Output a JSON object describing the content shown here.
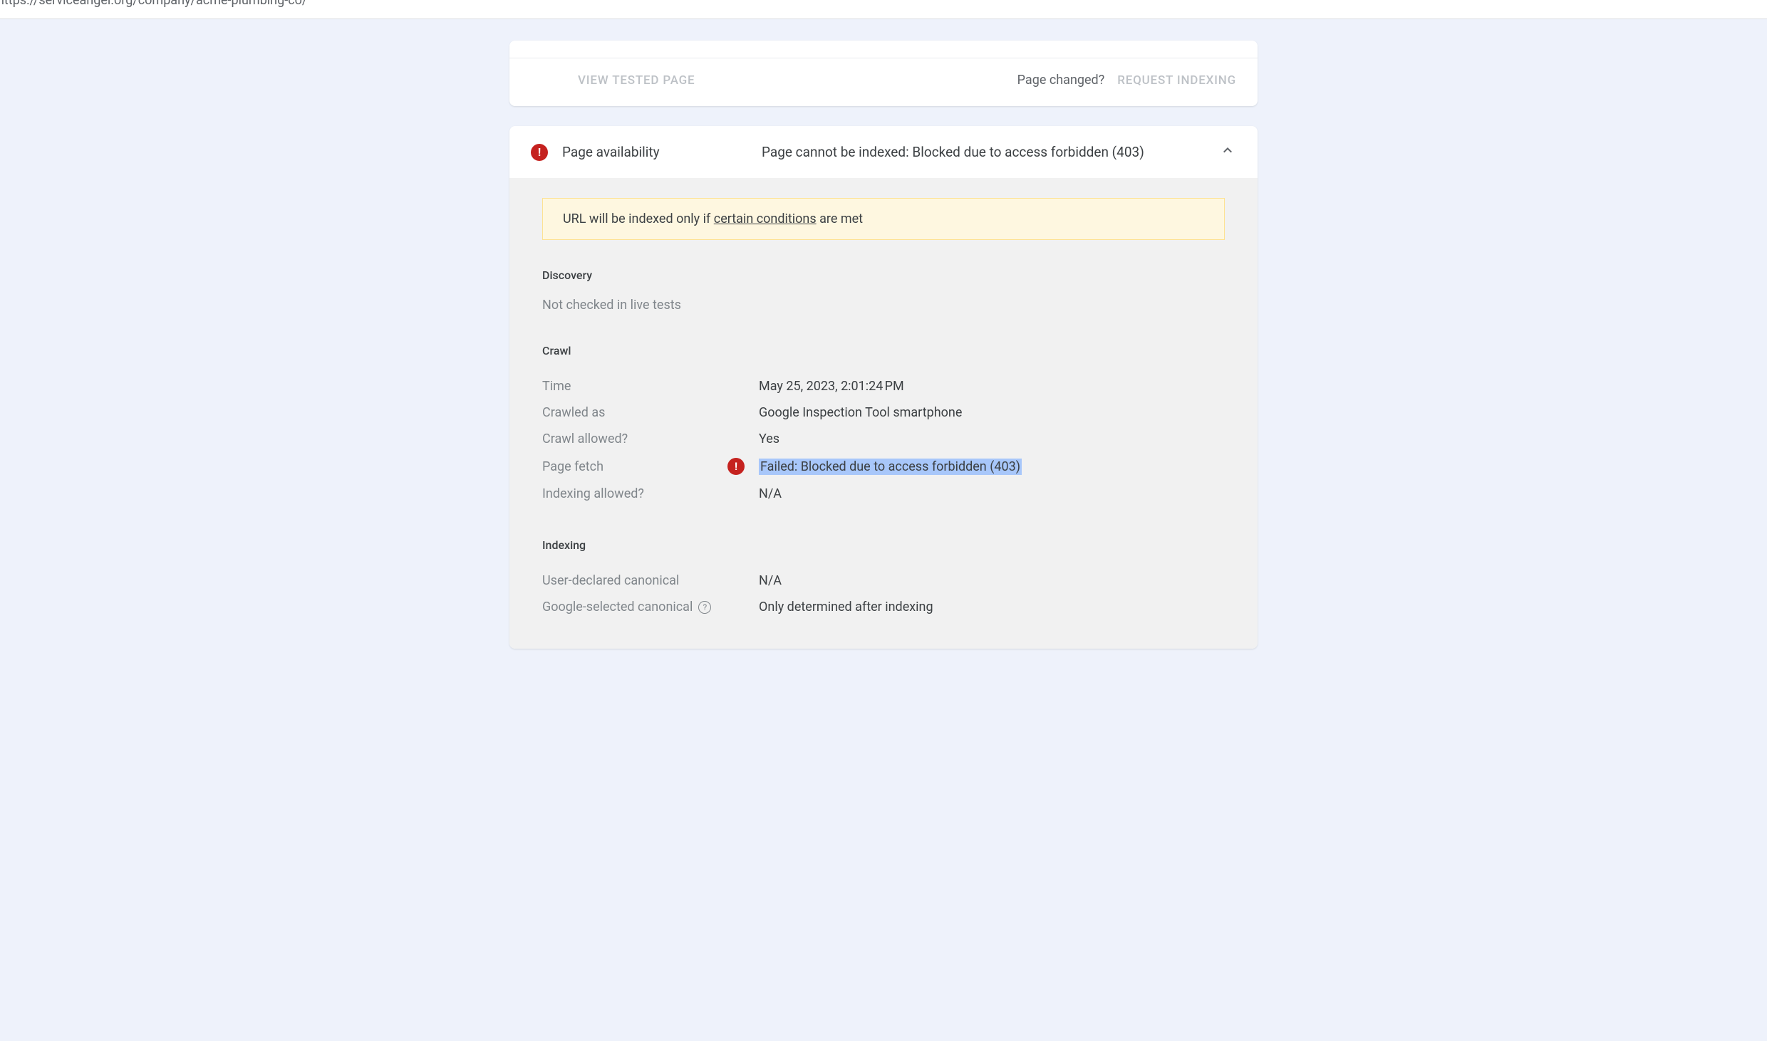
{
  "url": "https://serviceangel.org/company/acme-plumbing-co/",
  "action_bar": {
    "view_tested": "View tested page",
    "page_changed": "Page changed?",
    "request_indexing": "Request indexing"
  },
  "availability": {
    "title": "Page availability",
    "status": "Page cannot be indexed: Blocked due to access forbidden (403)",
    "banner_prefix": "URL will be indexed only if ",
    "banner_link": "certain conditions",
    "banner_suffix": " are met",
    "discovery": {
      "title": "Discovery",
      "value": "Not checked in live tests"
    },
    "crawl": {
      "title": "Crawl",
      "rows": {
        "time": {
          "label": "Time",
          "value": "May 25, 2023, 2:01:24 PM"
        },
        "crawled_as": {
          "label": "Crawled as",
          "value": "Google Inspection Tool smartphone"
        },
        "crawl_allowed": {
          "label": "Crawl allowed?",
          "value": "Yes"
        },
        "page_fetch": {
          "label": "Page fetch",
          "value": "Failed: Blocked due to access forbidden (403)"
        },
        "indexing_allowed": {
          "label": "Indexing allowed?",
          "value": "N/A"
        }
      }
    },
    "indexing": {
      "title": "Indexing",
      "rows": {
        "user_canonical": {
          "label": "User-declared canonical",
          "value": "N/A"
        },
        "google_canonical": {
          "label": "Google-selected canonical",
          "value": "Only determined after indexing"
        }
      }
    }
  }
}
